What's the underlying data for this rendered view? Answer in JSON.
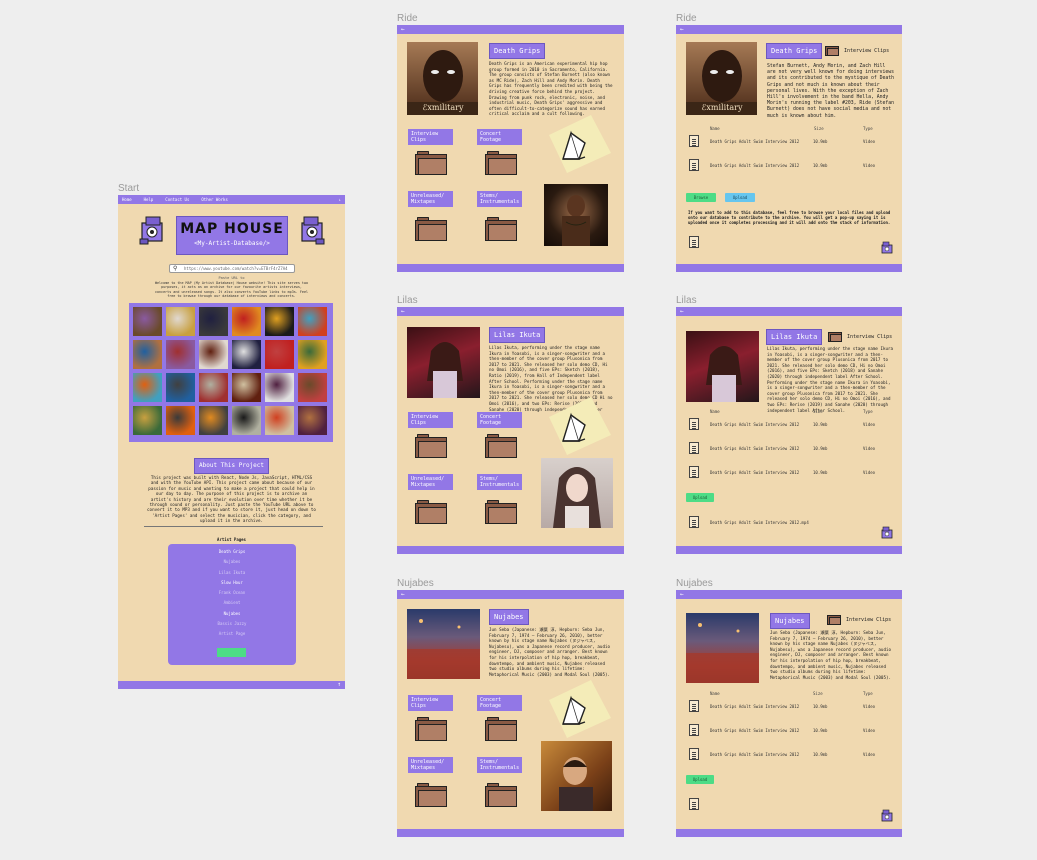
{
  "frames": {
    "start": "Start",
    "ride_1": "Ride",
    "ride_2": "Ride",
    "lilas_1": "Lilas",
    "lilas_2": "Lilas",
    "nujabes_1": "Nujabes",
    "nujabes_2": "Nujabes"
  },
  "start": {
    "nav": [
      "Home",
      "Help",
      "Contact Us",
      "Other Works"
    ],
    "logo_text": "MAP HOUSE",
    "logo_sub": "<My-Artist-Database/>",
    "search_value": "https://www.youtube.com/watch?v=ETBrF4rZ7A4",
    "search_hint": "Paste URL to",
    "welcome_text": "Welcome to the MAP (My Artist Database) House website! This site serves two purposes, it acts as an archive for our favourite artists interviews, concerts and unreleased songs. It also converts YouTube links to mp3s. Feel free to browse through our database of interviews and concerts.",
    "about_title": "About This Project",
    "about_text": "This project was built with React, Node Js, JavaScript, HTML/CSS and with the YouTube API. This project came about because of our passion for music and wanting to make a project that could help in our day to day. The purpose of this project is to archive an artist's history and are their evolution over time whether it be through sound or personality. Just paste the YouTube URL above to convert it to MP3 and if you want to store it, just head on down to 'Artist Pages' and select the musician, click the category, and upload it in the archive.",
    "artist_pages_title": "Artist Pages",
    "artists": [
      "Death Grips",
      "Nujabes",
      "Lilas Ikuta",
      "Slow Hour",
      "Frank Ocean",
      "Ambient",
      "Nujabes",
      "Bassis Jazzy",
      "Artist Page"
    ]
  },
  "ride1": {
    "title": "Death Grips",
    "description": "Death Grips is an American experimental hip hop group formed in 2010 in Sacramento, California. The group consists of Stefan Burnett (also known as MC Ride), Zach Hill and Andy Morin. Death Grips has frequently been credited with being the driving creative force behind the project. Drawing from punk rock, electronic, noise, and industrial music, Death Grips' aggressive and often difficult-to-categorize sound has earned critical acclaim and a cult following.",
    "tabs": {
      "interview": "Interview Clips",
      "concert": "Concert Footage",
      "unreleased": "Unreleased/ Mixtapes",
      "stems": "Stems/ Instrumentals"
    }
  },
  "ride2": {
    "title": "Death Grips",
    "section": "Interview Clips",
    "description": "Stefan Burnett, Andy Morin, and Zach Hill are not very well known for doing interviews and its contributed to the mystique of Death Grips and not much is known about their personal lives. With the exception of Zach Hill's involvement in the band Hella, Andy Morin's running the label #203, Ride (Stefan Burnett) does not have social media and not much is known about him.",
    "columns": [
      "Name",
      "Size",
      "Type"
    ],
    "rows": [
      {
        "name": "Death Grips Adult Swim Interview 2012",
        "size": "10.9mb",
        "type": "Video"
      },
      {
        "name": "Death Grips Adult Swim Interview 2012",
        "size": "10.9mb",
        "type": "Video"
      }
    ],
    "browse": "Browse",
    "upload": "Upload",
    "note": "If you want to add to this database, feel free to browse your local files and upload onto our database to contribute to the archive. You will get a pop-up saying it is uploaded once it completes processing and it will add onto the stack of information."
  },
  "lilas1": {
    "title": "Lilas Ikuta",
    "description": "Lilas Ikuta, performing under the stage name Ikura in Yoasobi, is a singer-songwriter and a then-member of the cover group Plusonica from 2017 to 2021. She released her solo demo CD, Hi no Omoi (2016), and five EPs: Sketch (2018), Ratio (2019), from Hall of Independent label After School. Performing under the stage name Ikura in Yoasobi, is a singer-songwriter and a then-member of the cover group Plusonica from 2017 to 2021. She released her solo demo CD Hi no Omoi (2016), and two EPs: Rerise (2019) and Sanahe (2020) through independent label After School.",
    "tabs": {
      "interview": "Interview Clips",
      "concert": "Concert Footage",
      "unreleased": "Unreleased/ Mixtapes",
      "stems": "Stems/ Instrumentals"
    }
  },
  "lilas2": {
    "title": "Lilas Ikuta",
    "section": "Interview Clips",
    "description": "Lilas Ikuta, performing under the stage name Ikura in Yoasobi, is a singer-songwriter and a then-member of the cover group Plusonica from 2017 to 2021. She released her solo demo CD, Hi no Omoi (2016), and five EPs: Sketch (2018) and Sanahe (2020) through independent label After School. Performing under the stage name Ikura in Yoasobi, is a singer-songwriter and a then-member of the cover group Plusonica from 2017 to 2021. She released her solo demo CD, Hi no Omoi (2016), and two EPs: Rerise (2019) and Sanahe (2020) through independent label After School.",
    "columns": [
      "Name",
      "Size",
      "Type"
    ],
    "rows": [
      {
        "name": "Death Grips Adult Swim Interview 2012",
        "size": "10.9mb",
        "type": "Video"
      },
      {
        "name": "Death Grips Adult Swim Interview 2012",
        "size": "10.9mb",
        "type": "Video"
      },
      {
        "name": "Death Grips Adult Swim Interview 2012",
        "size": "10.9mb",
        "type": "Video"
      }
    ],
    "upload": "Upload",
    "file": "Death Grips Adult Swim Interview 2012.mp4"
  },
  "nujabes1": {
    "title": "Nujabes",
    "description": "Jun Seba (Japanese: 瀬葉 淳, Hepburn: Seba Jun, February 7, 1974 – February 26, 2010), better known by his stage name Nujabes (ヌジャベス, Nujabesu), was a Japanese record producer, audio engineer, DJ, composer and arranger. Best known for his interpolation of hip hop, breakbeat, downtempo, and ambient music, Nujabes released two studio albums during his lifetime: Metaphorical Music (2003) and Modal Soul (2005).",
    "tabs": {
      "interview": "Interview Clips",
      "concert": "Concert Footage",
      "unreleased": "Unreleased/ Mixtapes",
      "stems": "Stems/ Instrumentals"
    }
  },
  "nujabes2": {
    "title": "Nujabes",
    "section": "Interview Clips",
    "description": "Jun Seba (Japanese: 瀬葉 淳, Hepburn: Seba Jun, February 7, 1974 – February 26, 2010), better known by his stage name Nujabes (ヌジャベス, Nujabesu), was a Japanese record producer, audio engineer, DJ, composer and arranger. Best known for his interpolation of hip hop, breakbeat, downtempo, and ambient music, Nujabes released two studio albums during his lifetime: Metaphorical Music (2003) and Modal Soul (2005).",
    "columns": [
      "Name",
      "Size",
      "Type"
    ],
    "rows": [
      {
        "name": "Death Grips Adult Swim Interview 2012",
        "size": "10.9mb",
        "type": "Video"
      },
      {
        "name": "Death Grips Adult Swim Interview 2012",
        "size": "10.9mb",
        "type": "Video"
      },
      {
        "name": "Death Grips Adult Swim Interview 2012",
        "size": "10.9mb",
        "type": "Video"
      }
    ],
    "upload": "Upload"
  },
  "colors": {
    "background": "#eeeeee",
    "panel": "#f0d9b0",
    "accent": "#9277e6",
    "green": "#4ddc86",
    "blue": "#66c6ee",
    "folder": "#8a5a44"
  }
}
